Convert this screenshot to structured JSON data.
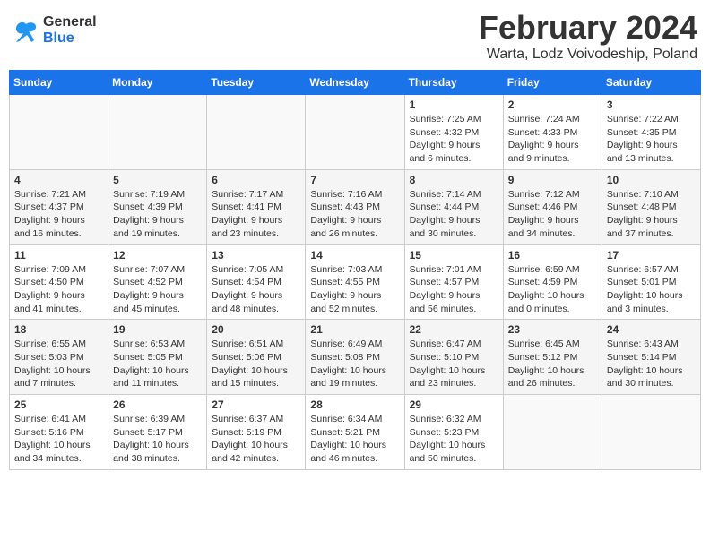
{
  "header": {
    "logo_line1": "General",
    "logo_line2": "Blue",
    "month": "February 2024",
    "location": "Warta, Lodz Voivodeship, Poland"
  },
  "days_of_week": [
    "Sunday",
    "Monday",
    "Tuesday",
    "Wednesday",
    "Thursday",
    "Friday",
    "Saturday"
  ],
  "weeks": [
    [
      {
        "day": "",
        "info": ""
      },
      {
        "day": "",
        "info": ""
      },
      {
        "day": "",
        "info": ""
      },
      {
        "day": "",
        "info": ""
      },
      {
        "day": "1",
        "info": "Sunrise: 7:25 AM\nSunset: 4:32 PM\nDaylight: 9 hours\nand 6 minutes."
      },
      {
        "day": "2",
        "info": "Sunrise: 7:24 AM\nSunset: 4:33 PM\nDaylight: 9 hours\nand 9 minutes."
      },
      {
        "day": "3",
        "info": "Sunrise: 7:22 AM\nSunset: 4:35 PM\nDaylight: 9 hours\nand 13 minutes."
      }
    ],
    [
      {
        "day": "4",
        "info": "Sunrise: 7:21 AM\nSunset: 4:37 PM\nDaylight: 9 hours\nand 16 minutes."
      },
      {
        "day": "5",
        "info": "Sunrise: 7:19 AM\nSunset: 4:39 PM\nDaylight: 9 hours\nand 19 minutes."
      },
      {
        "day": "6",
        "info": "Sunrise: 7:17 AM\nSunset: 4:41 PM\nDaylight: 9 hours\nand 23 minutes."
      },
      {
        "day": "7",
        "info": "Sunrise: 7:16 AM\nSunset: 4:43 PM\nDaylight: 9 hours\nand 26 minutes."
      },
      {
        "day": "8",
        "info": "Sunrise: 7:14 AM\nSunset: 4:44 PM\nDaylight: 9 hours\nand 30 minutes."
      },
      {
        "day": "9",
        "info": "Sunrise: 7:12 AM\nSunset: 4:46 PM\nDaylight: 9 hours\nand 34 minutes."
      },
      {
        "day": "10",
        "info": "Sunrise: 7:10 AM\nSunset: 4:48 PM\nDaylight: 9 hours\nand 37 minutes."
      }
    ],
    [
      {
        "day": "11",
        "info": "Sunrise: 7:09 AM\nSunset: 4:50 PM\nDaylight: 9 hours\nand 41 minutes."
      },
      {
        "day": "12",
        "info": "Sunrise: 7:07 AM\nSunset: 4:52 PM\nDaylight: 9 hours\nand 45 minutes."
      },
      {
        "day": "13",
        "info": "Sunrise: 7:05 AM\nSunset: 4:54 PM\nDaylight: 9 hours\nand 48 minutes."
      },
      {
        "day": "14",
        "info": "Sunrise: 7:03 AM\nSunset: 4:55 PM\nDaylight: 9 hours\nand 52 minutes."
      },
      {
        "day": "15",
        "info": "Sunrise: 7:01 AM\nSunset: 4:57 PM\nDaylight: 9 hours\nand 56 minutes."
      },
      {
        "day": "16",
        "info": "Sunrise: 6:59 AM\nSunset: 4:59 PM\nDaylight: 10 hours\nand 0 minutes."
      },
      {
        "day": "17",
        "info": "Sunrise: 6:57 AM\nSunset: 5:01 PM\nDaylight: 10 hours\nand 3 minutes."
      }
    ],
    [
      {
        "day": "18",
        "info": "Sunrise: 6:55 AM\nSunset: 5:03 PM\nDaylight: 10 hours\nand 7 minutes."
      },
      {
        "day": "19",
        "info": "Sunrise: 6:53 AM\nSunset: 5:05 PM\nDaylight: 10 hours\nand 11 minutes."
      },
      {
        "day": "20",
        "info": "Sunrise: 6:51 AM\nSunset: 5:06 PM\nDaylight: 10 hours\nand 15 minutes."
      },
      {
        "day": "21",
        "info": "Sunrise: 6:49 AM\nSunset: 5:08 PM\nDaylight: 10 hours\nand 19 minutes."
      },
      {
        "day": "22",
        "info": "Sunrise: 6:47 AM\nSunset: 5:10 PM\nDaylight: 10 hours\nand 23 minutes."
      },
      {
        "day": "23",
        "info": "Sunrise: 6:45 AM\nSunset: 5:12 PM\nDaylight: 10 hours\nand 26 minutes."
      },
      {
        "day": "24",
        "info": "Sunrise: 6:43 AM\nSunset: 5:14 PM\nDaylight: 10 hours\nand 30 minutes."
      }
    ],
    [
      {
        "day": "25",
        "info": "Sunrise: 6:41 AM\nSunset: 5:16 PM\nDaylight: 10 hours\nand 34 minutes."
      },
      {
        "day": "26",
        "info": "Sunrise: 6:39 AM\nSunset: 5:17 PM\nDaylight: 10 hours\nand 38 minutes."
      },
      {
        "day": "27",
        "info": "Sunrise: 6:37 AM\nSunset: 5:19 PM\nDaylight: 10 hours\nand 42 minutes."
      },
      {
        "day": "28",
        "info": "Sunrise: 6:34 AM\nSunset: 5:21 PM\nDaylight: 10 hours\nand 46 minutes."
      },
      {
        "day": "29",
        "info": "Sunrise: 6:32 AM\nSunset: 5:23 PM\nDaylight: 10 hours\nand 50 minutes."
      },
      {
        "day": "",
        "info": ""
      },
      {
        "day": "",
        "info": ""
      }
    ]
  ]
}
